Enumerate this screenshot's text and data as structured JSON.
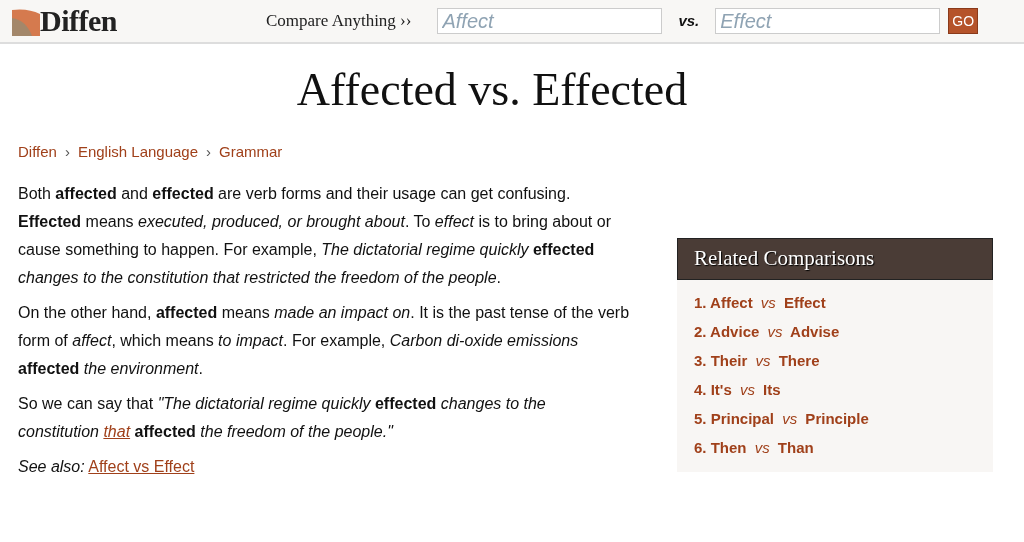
{
  "header": {
    "logo": "Diffen",
    "compare_label": "Compare Anything ››",
    "field_1": {
      "placeholder": "Affect"
    },
    "vs": "vs.",
    "field_2": {
      "placeholder": "Effect"
    },
    "go_button": "GO"
  },
  "title": "Affected vs. Effected",
  "breadcrumb": [
    "Diffen",
    "English Language",
    "Grammar"
  ],
  "breadcrumb_separator": "›",
  "paragraphs": [
    {
      "parts": [
        {
          "kind": "text",
          "text": "Both **affected** and **effected** are verb forms and their usage can get confusing. **Effected** means *executed, produced, or brought about*. To *effect* is to bring about or cause something to happen. For example, *The dictatorial regime quickly* **effected** *changes to the constitution that restricted the freedom of the people*."
        }
      ]
    },
    {
      "parts": [
        {
          "kind": "text",
          "text": "On the other hand, **affected** means *made an impact on*. It is the past tense of the verb form of *affect*, which means *to impact*. For example, *Carbon di-oxide emissions* **affected** *the environment*."
        }
      ]
    },
    {
      "parts": [
        {
          "kind": "text",
          "text": "So we can say that *\"The dictatorial regime quickly* **effected** *changes to the constitution*"
        },
        {
          "kind": "link",
          "text": "that"
        },
        {
          "kind": "text",
          "text": "**affected** *the freedom of the people.\"*"
        }
      ]
    }
  ],
  "see_also": {
    "label": "See also:",
    "link": "Affect vs Effect"
  },
  "related": {
    "title": "Related Comparisons",
    "items": [
      {
        "text": "1. Affect *vs* Effect"
      },
      {
        "text": "2. Advice *vs* Advise"
      },
      {
        "text": "3. Their *vs* There"
      },
      {
        "text": "4. It's *vs* Its"
      },
      {
        "text": "5. Principal *vs* Principle"
      },
      {
        "text": "6. Then *vs* Than"
      }
    ]
  }
}
